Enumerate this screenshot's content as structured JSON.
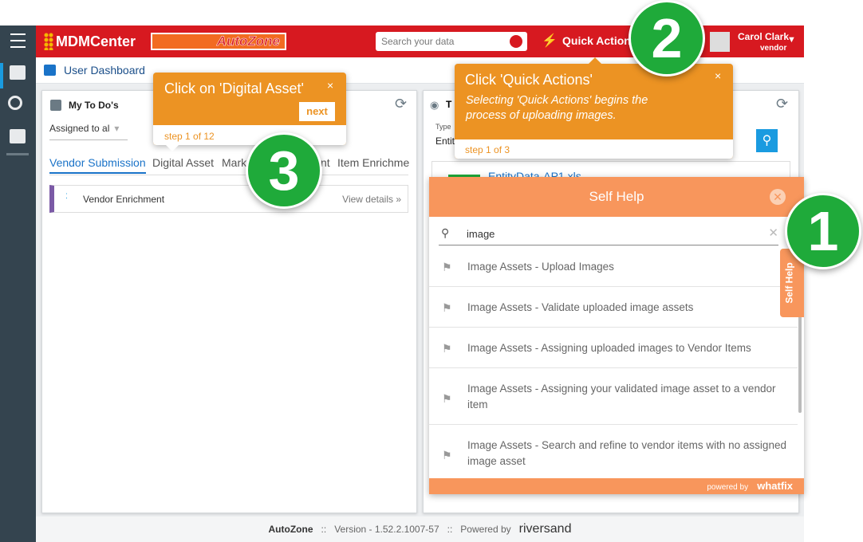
{
  "header": {
    "brand": "MDMCenter",
    "logo": "AutoZone",
    "search_placeholder": "Search your data",
    "quick_actions": "Quick Actions",
    "user_name": "Carol Clark",
    "user_role": "vendor"
  },
  "subheader": {
    "title": "User Dashboard"
  },
  "todo": {
    "title": "My To Do's",
    "filter": "Assigned to al",
    "tabs": [
      "Vendor Submission",
      "Digital Asset",
      "Mark",
      "nt",
      "Item Enrichme"
    ],
    "item": "Vendor Enrichment",
    "view_details": "View details »"
  },
  "right_card": {
    "title": "T",
    "type_label": "Type",
    "type_value": "Entit",
    "file": "EntityData-AP1.xls"
  },
  "tooltip_digital": {
    "title": "Click on 'Digital Asset'",
    "next": "next",
    "step": "step 1 of 12",
    "close": "×"
  },
  "tooltip_quick": {
    "title": "Click 'Quick Actions'",
    "body": "Selecting 'Quick Actions' begins the process of uploading images.",
    "step": "step 1 of 3",
    "close": "×"
  },
  "self_help": {
    "title": "Self Help",
    "search_value": "image",
    "tab": "Self Help",
    "powered_by": "powered by",
    "powered_brand": "whatfix",
    "items": [
      "Image Assets - Upload Images",
      "Image Assets - Validate uploaded image assets",
      "Image Assets - Assigning uploaded images to Vendor Items",
      "Image Assets - Assigning your validated image asset to a vendor item",
      "Image Assets - Search and refine to vendor items with no assigned image asset"
    ]
  },
  "markers": [
    "1",
    "2",
    "3"
  ],
  "footer": {
    "company": "AutoZone",
    "sep": "::",
    "version": "Version - 1.52.2.1007-57",
    "powered": "Powered by",
    "brand": "riversand"
  },
  "colors": {
    "header": "#d71920",
    "sidebar": "#34444f",
    "tooltip": "#ec9323",
    "self_help": "#f8965c",
    "marker": "#1faa3a",
    "accent": "#1a73c8"
  }
}
